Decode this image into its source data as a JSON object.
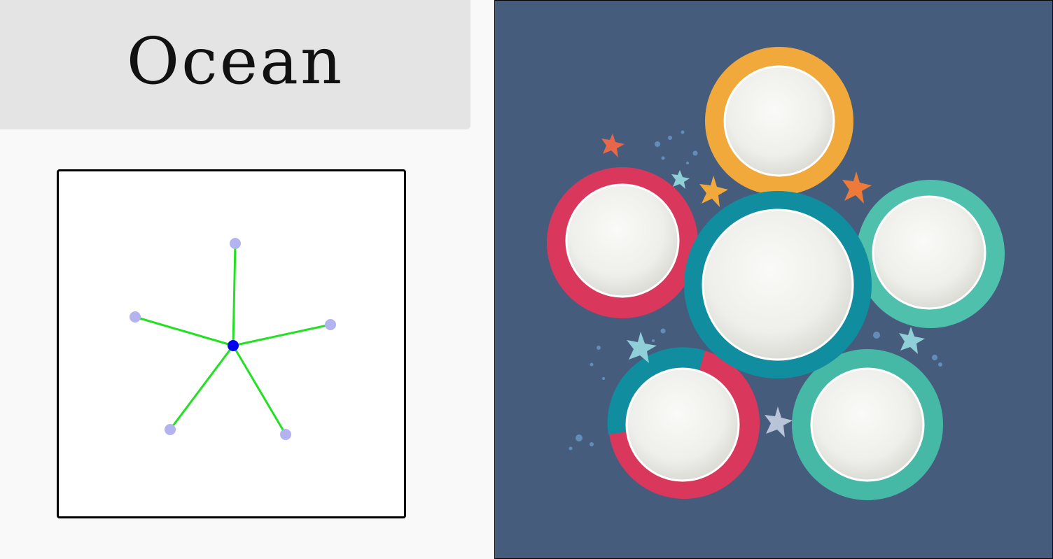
{
  "header": {
    "title": "Ocean"
  },
  "graph": {
    "center_node": {
      "color": "#0000ee"
    },
    "leaf_color": "#b3b3f0",
    "edge_color": "#22e022",
    "leaf_count": 5
  },
  "illustration": {
    "background_color": "#465c7c",
    "plate_colors": [
      "#f0a93a",
      "#d9385c",
      "#108ea0",
      "#4ec0ac",
      "#46b8a6"
    ]
  }
}
